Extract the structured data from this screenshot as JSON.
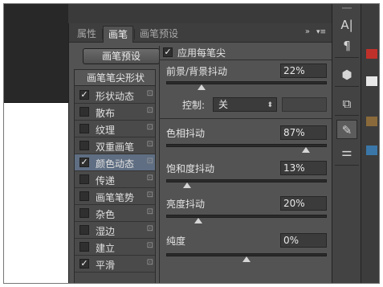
{
  "tabs": [
    "属性",
    "画笔",
    "画笔预设"
  ],
  "active_tab": 1,
  "panel_collapse_glyph": "»",
  "panel_menu_glyph": "▾≡",
  "preset_button": "画笔预设",
  "list_header": "画笔笔尖形状",
  "list_items": [
    {
      "label": "形状动态",
      "checked": true,
      "selected": false
    },
    {
      "label": "散布",
      "checked": false,
      "selected": false
    },
    {
      "label": "纹理",
      "checked": false,
      "selected": false
    },
    {
      "label": "双重画笔",
      "checked": false,
      "selected": false
    },
    {
      "label": "颜色动态",
      "checked": true,
      "selected": true
    },
    {
      "label": "传递",
      "checked": false,
      "selected": false
    },
    {
      "label": "画笔笔势",
      "checked": false,
      "selected": false
    },
    {
      "label": "杂色",
      "checked": false,
      "selected": false
    },
    {
      "label": "湿边",
      "checked": false,
      "selected": false
    },
    {
      "label": "建立",
      "checked": false,
      "selected": false
    },
    {
      "label": "平滑",
      "checked": true,
      "selected": false
    }
  ],
  "apply_per_tip": {
    "label": "应用每笔尖",
    "checked": true
  },
  "settings": {
    "fg_bg_jitter": {
      "label": "前景/背景抖动",
      "value": "22%"
    },
    "control": {
      "label": "控制:",
      "value": "关"
    },
    "hue_jitter": {
      "label": "色相抖动",
      "value": "87%"
    },
    "saturation_jitter": {
      "label": "饱和度抖动",
      "value": "13%"
    },
    "brightness_jitter": {
      "label": "亮度抖动",
      "value": "20%"
    },
    "purity": {
      "label": "纯度",
      "value": "0%"
    }
  },
  "slider_levels": {
    "fg_bg_jitter": 0.22,
    "hue_jitter": 0.87,
    "saturation_jitter": 0.13,
    "brightness_jitter": 0.2,
    "purity": 0.5
  },
  "dock_icons": [
    "character-icon",
    "paragraph-icon",
    "3d-cube-icon",
    "clone-source-icon",
    "brush-icon",
    "brush-presets-icon"
  ],
  "dock_glyphs": [
    "A|",
    "¶",
    "⬢",
    "⧉",
    "✎",
    "⚌"
  ],
  "colors": {
    "selected_row": "#5f6e82",
    "panel_bg": "#535353",
    "tab_bar": "#3e3e3e"
  }
}
